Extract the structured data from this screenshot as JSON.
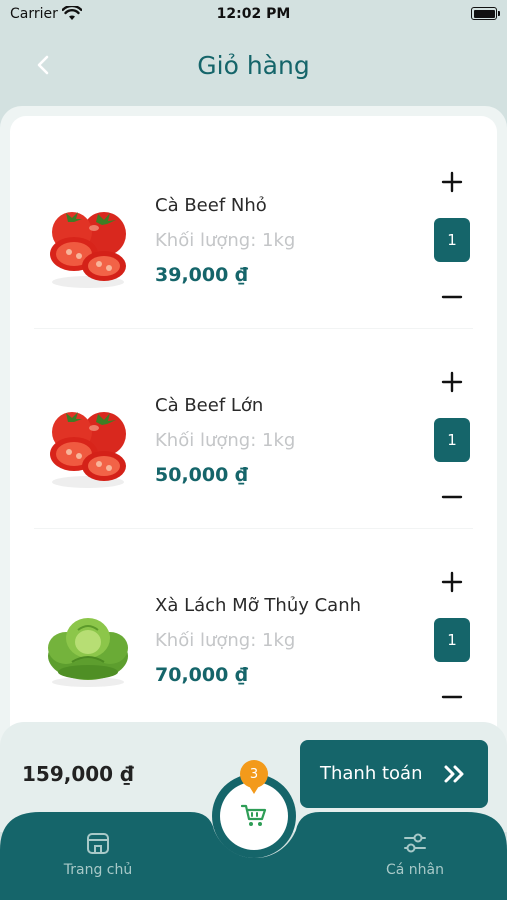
{
  "status_bar": {
    "carrier": "Carrier",
    "time": "12:02 PM"
  },
  "header": {
    "title": "Giỏ hàng"
  },
  "cart": {
    "items": [
      {
        "name": "Cà Beef Nhỏ",
        "weight": "Khối lượng: 1kg",
        "price": "39,000 ₫",
        "quantity": "1",
        "image": "tomato"
      },
      {
        "name": "Cà Beef Lớn",
        "weight": "Khối lượng: 1kg",
        "price": "50,000 ₫",
        "quantity": "1",
        "image": "tomato"
      },
      {
        "name": "Xà Lách Mỡ Thủy Canh",
        "weight": "Khối lượng: 1kg",
        "price": "70,000 ₫",
        "quantity": "1",
        "image": "lettuce"
      }
    ]
  },
  "checkout": {
    "total": "159,000 ₫",
    "button_label": "Thanh toán"
  },
  "tabbar": {
    "home_label": "Trang chủ",
    "profile_label": "Cá nhân",
    "cart_badge": "3"
  },
  "colors": {
    "primary": "#15656a",
    "badge": "#f39a1b",
    "background": "#d3e1e0"
  }
}
